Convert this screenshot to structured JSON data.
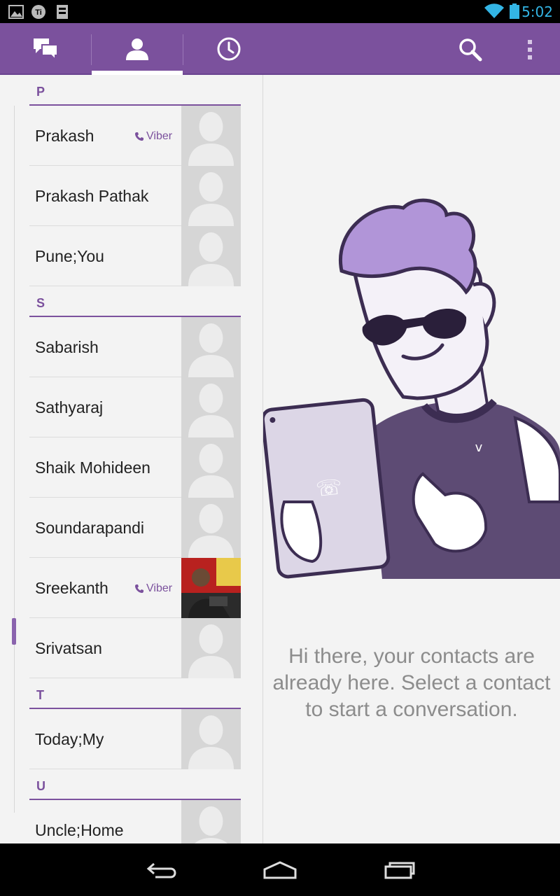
{
  "status_bar": {
    "time": "5:02",
    "notification_icons": [
      "gallery-icon",
      "ti-app-icon",
      "ftp-icon"
    ],
    "accent": "#33b5e5"
  },
  "action_bar": {
    "tabs": [
      {
        "name": "chats",
        "icon": "chat-bubbles-icon",
        "selected": false
      },
      {
        "name": "contacts",
        "icon": "person-icon",
        "selected": true
      },
      {
        "name": "recents",
        "icon": "clock-icon",
        "selected": false
      }
    ],
    "actions": [
      "search-icon",
      "overflow-menu-icon"
    ],
    "color": "#7b519d"
  },
  "contacts": {
    "sections": [
      {
        "letter": "P",
        "contacts": [
          {
            "name": "Prakash",
            "viber": "Viber"
          },
          {
            "name": "Prakash Pathak",
            "viber": ""
          },
          {
            "name": "Pune;You",
            "viber": ""
          }
        ]
      },
      {
        "letter": "S",
        "contacts": [
          {
            "name": "Sabarish",
            "viber": ""
          },
          {
            "name": "Sathyaraj",
            "viber": ""
          },
          {
            "name": "Shaik Mohideen",
            "viber": ""
          },
          {
            "name": "Soundarapandi",
            "viber": ""
          },
          {
            "name": "Sreekanth",
            "viber": "Viber"
          },
          {
            "name": "Srivatsan",
            "viber": ""
          }
        ]
      },
      {
        "letter": "T",
        "contacts": [
          {
            "name": "Today;My",
            "viber": ""
          }
        ]
      },
      {
        "letter": "U",
        "contacts": [
          {
            "name": "Uncle;Home",
            "viber": ""
          }
        ]
      }
    ]
  },
  "empty_state": {
    "message": "Hi there, your contacts are already here. Select a contact to start a conversation."
  },
  "nav_bar": {
    "buttons": [
      "back-icon",
      "home-icon",
      "recent-apps-icon"
    ]
  }
}
